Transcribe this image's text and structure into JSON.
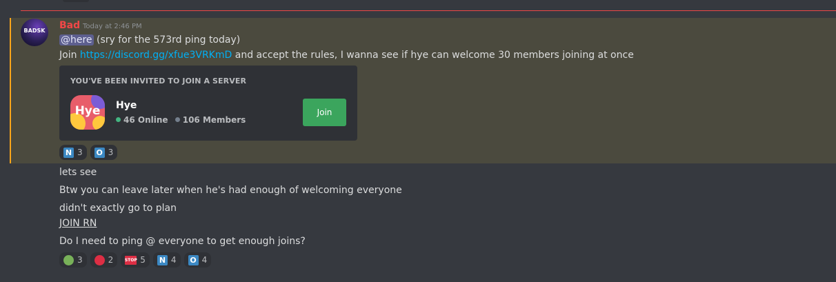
{
  "message": {
    "author": "Bad",
    "author_color": "#f04747",
    "avatar_text": "BADSK",
    "timestamp": "Today at 2:46 PM",
    "line1": {
      "mention": "@here",
      "text": " (sry for the 573rd ping today)"
    },
    "line2": {
      "prefix": "Join ",
      "link": "https://discord.gg/xfue3VRKmD",
      "suffix": " and accept the rules, I wanna see if hye can welcome 30 members joining at once"
    },
    "invite": {
      "heading": "YOU'VE BEEN INVITED TO JOIN A SERVER",
      "icon_text": "Hye",
      "server_name": "Hye",
      "online": "46 Online",
      "members": "106 Members",
      "join_label": "Join"
    },
    "reactions": [
      {
        "emoji": "letter-n",
        "label": "N",
        "count": "3"
      },
      {
        "emoji": "letter-o",
        "label": "O",
        "count": "3"
      }
    ]
  },
  "followups": [
    "lets see",
    "Btw you can leave later when he's had enough of welcoming everyone",
    "didn't exactly go to plan",
    "JOIN RN",
    "Do I need to ping @ everyone to get enough joins?"
  ],
  "followup_reactions": [
    {
      "emoji": "green-circle",
      "count": "3"
    },
    {
      "emoji": "red-circle",
      "count": "2"
    },
    {
      "emoji": "stop-sign",
      "label": "STOP",
      "count": "5"
    },
    {
      "emoji": "letter-n",
      "label": "N",
      "count": "4"
    },
    {
      "emoji": "letter-o",
      "label": "O",
      "count": "4"
    }
  ],
  "colors": {
    "background": "#36393f",
    "highlight": "#4b4a3e",
    "highlight_border": "#faa61a",
    "new_divider": "#f04747",
    "link": "#00b0f4",
    "join_button": "#3ba55d"
  }
}
